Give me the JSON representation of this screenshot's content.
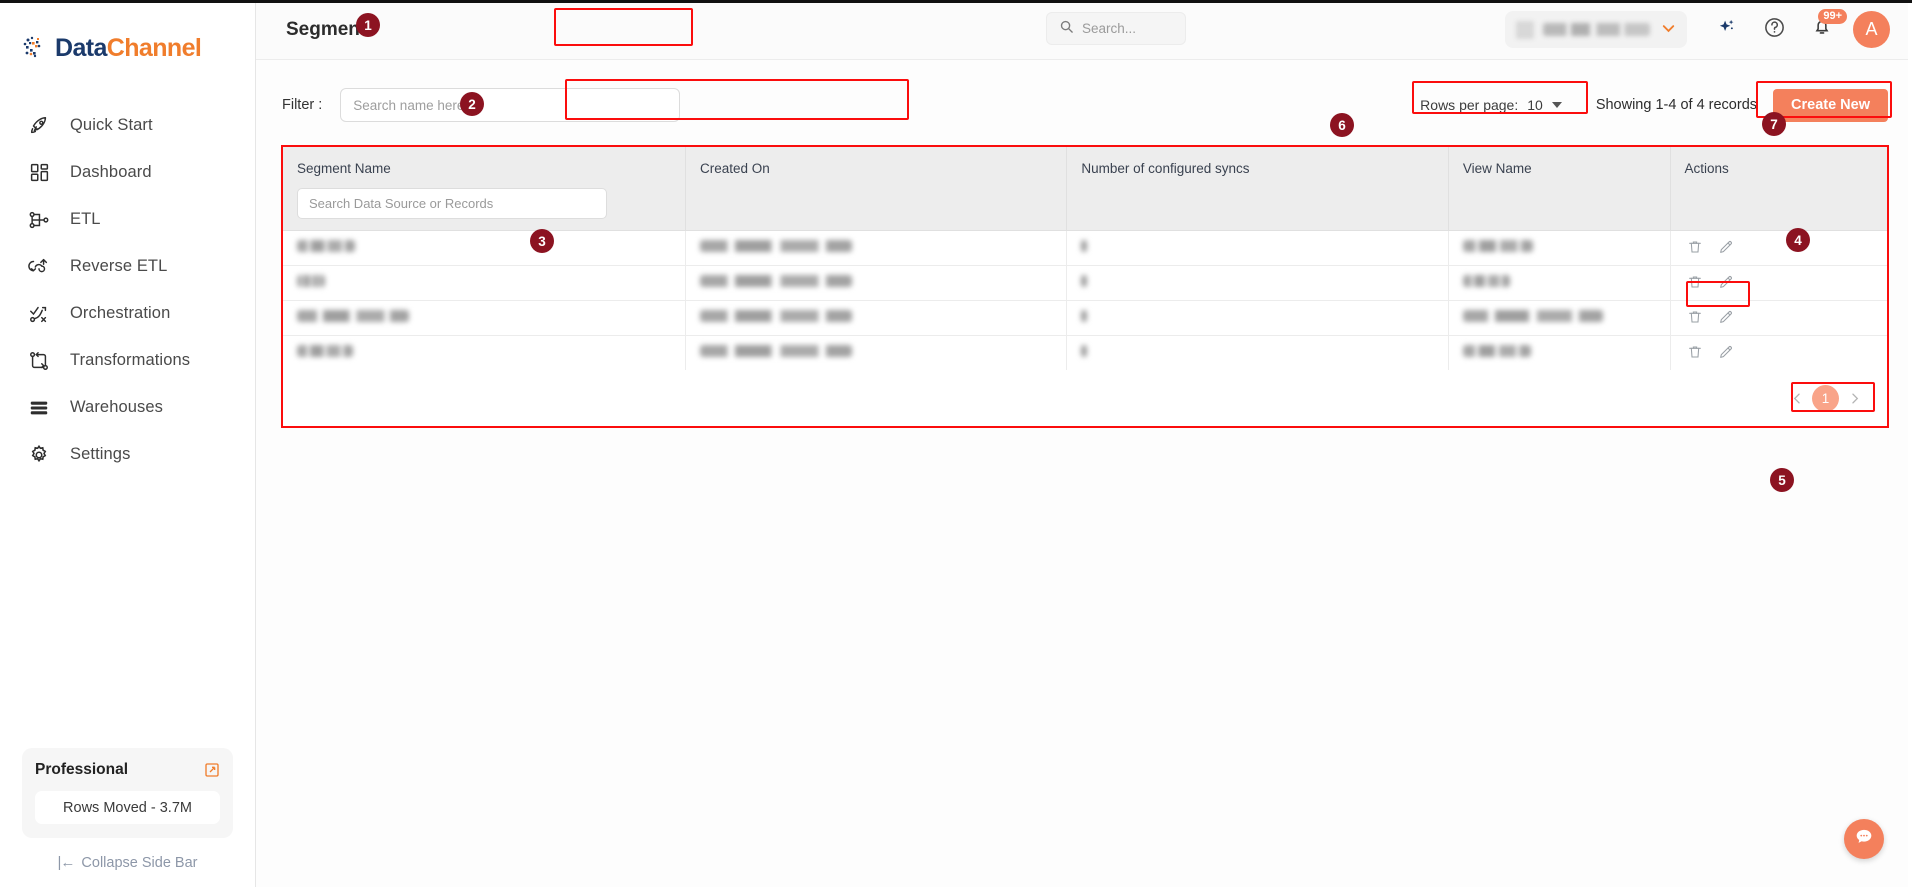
{
  "brand": {
    "name_part1": "Data",
    "name_part2": "Channel",
    "logo_icon": "datachannel-logo-icon"
  },
  "sidebar": {
    "items": [
      {
        "label": "Quick Start",
        "icon": "rocket-icon"
      },
      {
        "label": "Dashboard",
        "icon": "grid-dashboard-icon"
      },
      {
        "label": "ETL",
        "icon": "etl-nodes-icon"
      },
      {
        "label": "Reverse ETL",
        "icon": "reverse-etl-cloud-icon"
      },
      {
        "label": "Orchestration",
        "icon": "orchestration-flow-icon"
      },
      {
        "label": "Transformations",
        "icon": "transformations-swap-icon"
      },
      {
        "label": "Warehouses",
        "icon": "warehouse-stack-icon"
      },
      {
        "label": "Settings",
        "icon": "gear-icon"
      }
    ],
    "plan": {
      "name": "Professional",
      "upgrade_icon": "external-link-icon",
      "usage": "Rows Moved - 3.7M"
    },
    "collapse": {
      "label": "Collapse Side Bar",
      "icon": "collapse-left-icon"
    }
  },
  "topbar": {
    "title": "Segments",
    "search": {
      "placeholder": "Search...",
      "icon": "search-icon",
      "value": ""
    },
    "org_selector": {
      "value": "",
      "icon": "building-icon",
      "caret": "chevron-down-icon"
    },
    "ai_icon": "sparkle-ai-icon",
    "help_icon": "help-circle-icon",
    "notifications": {
      "icon": "bell-icon",
      "badge": "99+"
    },
    "avatar": {
      "initial": "A"
    }
  },
  "filter": {
    "label": "Filter :",
    "input": {
      "placeholder": "Search name here",
      "value": ""
    }
  },
  "toolbar": {
    "rows_per_page_label": "Rows per page:",
    "rows_per_page_value": "10",
    "rows_per_page_caret": "chevron-down-icon",
    "records_text": "Showing 1-4 of 4 records",
    "create_label": "Create New"
  },
  "table": {
    "columns": [
      "Segment Name",
      "Created On",
      "Number of configured syncs",
      "View Name",
      "Actions"
    ],
    "header_search": {
      "placeholder": "Search Data Source or Records",
      "value": ""
    },
    "row_action_icons": [
      "trash-icon",
      "pencil-edit-icon"
    ],
    "rows": [
      {
        "segment_name": "",
        "created_on": "",
        "syncs": "",
        "view_name": "",
        "name_w": 58,
        "created_w": 152,
        "syncs_w": 6,
        "view_w": 70
      },
      {
        "segment_name": "",
        "created_on": "",
        "syncs": "",
        "view_name": "",
        "name_w": 28,
        "created_w": 152,
        "syncs_w": 6,
        "view_w": 47
      },
      {
        "segment_name": "",
        "created_on": "",
        "syncs": "",
        "view_name": "",
        "name_w": 112,
        "created_w": 152,
        "syncs_w": 6,
        "view_w": 140
      },
      {
        "segment_name": "",
        "created_on": "",
        "syncs": "",
        "view_name": "",
        "name_w": 56,
        "created_w": 152,
        "syncs_w": 6,
        "view_w": 68
      }
    ]
  },
  "pagination": {
    "prev_icon": "chevron-left-icon",
    "next_icon": "chevron-right-icon",
    "current_page": "1"
  },
  "chat": {
    "icon": "chat-bubble-icon"
  },
  "annotations": {
    "steps": [
      {
        "number": "1",
        "target": "page-title"
      },
      {
        "number": "2",
        "target": "filter-input"
      },
      {
        "number": "3",
        "target": "segment-name-column"
      },
      {
        "number": "4",
        "target": "row-actions"
      },
      {
        "number": "5",
        "target": "pagination"
      },
      {
        "number": "6",
        "target": "rows-per-page"
      },
      {
        "number": "7",
        "target": "create-new-button"
      }
    ]
  },
  "colors": {
    "accent": "#f4805c",
    "brand_blue": "#1b3a6b",
    "brand_orange": "#f07d2c",
    "highlight": "#fb0d0d",
    "step_badge": "#8c1321"
  }
}
